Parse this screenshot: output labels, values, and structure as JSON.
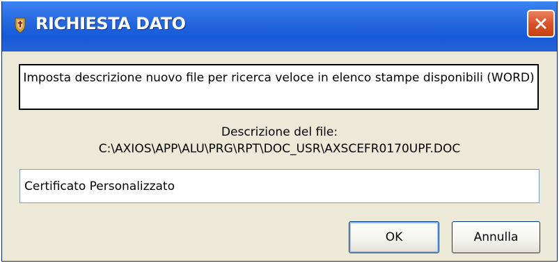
{
  "window": {
    "title": "RICHIESTA DATO",
    "icon": "app-icon",
    "close_icon": "close-icon",
    "accent_color": "#2768de",
    "close_color": "#d8532a"
  },
  "dialog": {
    "message": "Imposta descrizione nuovo file per ricerca veloce in elenco stampe disponibili (WORD)",
    "file_label": "Descrizione del file:",
    "file_path": "C:\\AXIOS\\APP\\ALU\\PRG\\RPT\\DOC_USR\\AXSCEFR0170UPF.DOC",
    "input_value": "Certificato Personalizzato"
  },
  "buttons": {
    "ok_label": "OK",
    "cancel_label": "Annulla"
  }
}
